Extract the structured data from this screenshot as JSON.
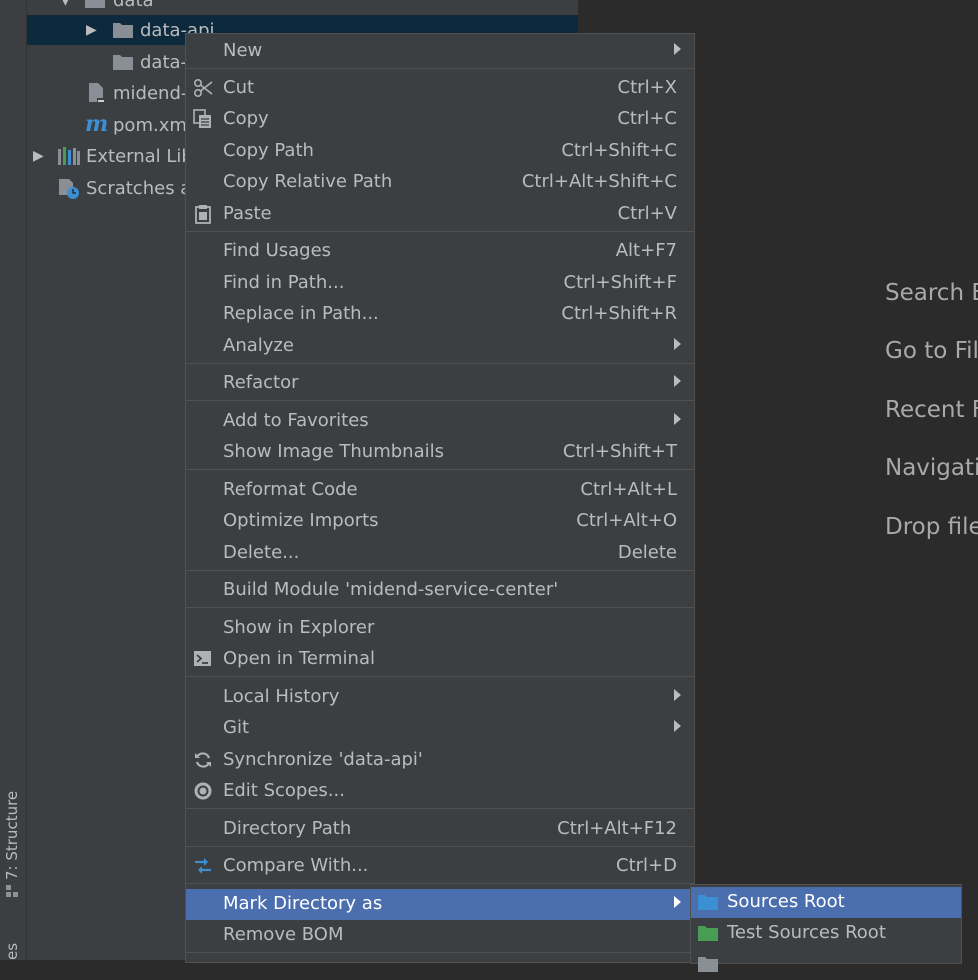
{
  "tool_stripe": {
    "structure_label": "7: Structure",
    "bottom_label": "es"
  },
  "project_tree": {
    "rows": [
      {
        "label": "data",
        "icon": "folder-icon"
      },
      {
        "label": "data-api",
        "icon": "folder-icon"
      },
      {
        "label": "data-",
        "icon": "folder-icon"
      },
      {
        "label": "midend-",
        "icon": "iml-file-icon"
      },
      {
        "label": "pom.xml",
        "icon": "maven-icon"
      },
      {
        "label": "External Lib",
        "icon": "library-icon"
      },
      {
        "label": "Scratches ar",
        "icon": "scratches-icon"
      }
    ]
  },
  "editor_hints": [
    "Search E",
    "Go to Fil",
    "Recent F",
    "Navigati",
    "Drop file"
  ],
  "context_menu": {
    "items": [
      {
        "label": "New",
        "shortcut": "",
        "submenu": true,
        "icon": ""
      },
      {
        "label": "Cut",
        "shortcut": "Ctrl+X",
        "submenu": false,
        "icon": "scissors-icon"
      },
      {
        "label": "Copy",
        "shortcut": "Ctrl+C",
        "submenu": false,
        "icon": "copy-icon"
      },
      {
        "label": "Copy Path",
        "shortcut": "Ctrl+Shift+C",
        "submenu": false,
        "icon": ""
      },
      {
        "label": "Copy Relative Path",
        "shortcut": "Ctrl+Alt+Shift+C",
        "submenu": false,
        "icon": ""
      },
      {
        "label": "Paste",
        "shortcut": "Ctrl+V",
        "submenu": false,
        "icon": "paste-icon"
      },
      {
        "label": "Find Usages",
        "shortcut": "Alt+F7",
        "submenu": false,
        "icon": ""
      },
      {
        "label": "Find in Path...",
        "shortcut": "Ctrl+Shift+F",
        "submenu": false,
        "icon": ""
      },
      {
        "label": "Replace in Path...",
        "shortcut": "Ctrl+Shift+R",
        "submenu": false,
        "icon": ""
      },
      {
        "label": "Analyze",
        "shortcut": "",
        "submenu": true,
        "icon": ""
      },
      {
        "label": "Refactor",
        "shortcut": "",
        "submenu": true,
        "icon": ""
      },
      {
        "label": "Add to Favorites",
        "shortcut": "",
        "submenu": true,
        "icon": ""
      },
      {
        "label": "Show Image Thumbnails",
        "shortcut": "Ctrl+Shift+T",
        "submenu": false,
        "icon": ""
      },
      {
        "label": "Reformat Code",
        "shortcut": "Ctrl+Alt+L",
        "submenu": false,
        "icon": ""
      },
      {
        "label": "Optimize Imports",
        "shortcut": "Ctrl+Alt+O",
        "submenu": false,
        "icon": ""
      },
      {
        "label": "Delete...",
        "shortcut": "Delete",
        "submenu": false,
        "icon": ""
      },
      {
        "label": "Build Module 'midend-service-center'",
        "shortcut": "",
        "submenu": false,
        "icon": ""
      },
      {
        "label": "Show in Explorer",
        "shortcut": "",
        "submenu": false,
        "icon": ""
      },
      {
        "label": "Open in Terminal",
        "shortcut": "",
        "submenu": false,
        "icon": "terminal-icon"
      },
      {
        "label": "Local History",
        "shortcut": "",
        "submenu": true,
        "icon": ""
      },
      {
        "label": "Git",
        "shortcut": "",
        "submenu": true,
        "icon": ""
      },
      {
        "label": "Synchronize 'data-api'",
        "shortcut": "",
        "submenu": false,
        "icon": "sync-icon"
      },
      {
        "label": "Edit Scopes...",
        "shortcut": "",
        "submenu": false,
        "icon": "scopes-icon"
      },
      {
        "label": "Directory Path",
        "shortcut": "Ctrl+Alt+F12",
        "submenu": false,
        "icon": ""
      },
      {
        "label": "Compare With...",
        "shortcut": "Ctrl+D",
        "submenu": false,
        "icon": "compare-icon"
      },
      {
        "label": "Mark Directory as",
        "shortcut": "",
        "submenu": true,
        "icon": "",
        "highlighted": true
      },
      {
        "label": "Remove BOM",
        "shortcut": "",
        "submenu": false,
        "icon": ""
      }
    ]
  },
  "mark_directory_submenu": {
    "items": [
      {
        "label": "Sources Root",
        "icon": "sources-root-folder-icon",
        "color": "#3d8fd4",
        "highlighted": true
      },
      {
        "label": "Test Sources Root",
        "icon": "test-sources-root-folder-icon",
        "color": "#499c54"
      }
    ]
  },
  "colors": {
    "menu_bg": "#3c3f41",
    "highlight": "#4b6eaf",
    "tree_selection": "#0d293e",
    "editor_bg": "#2b2b2b"
  }
}
